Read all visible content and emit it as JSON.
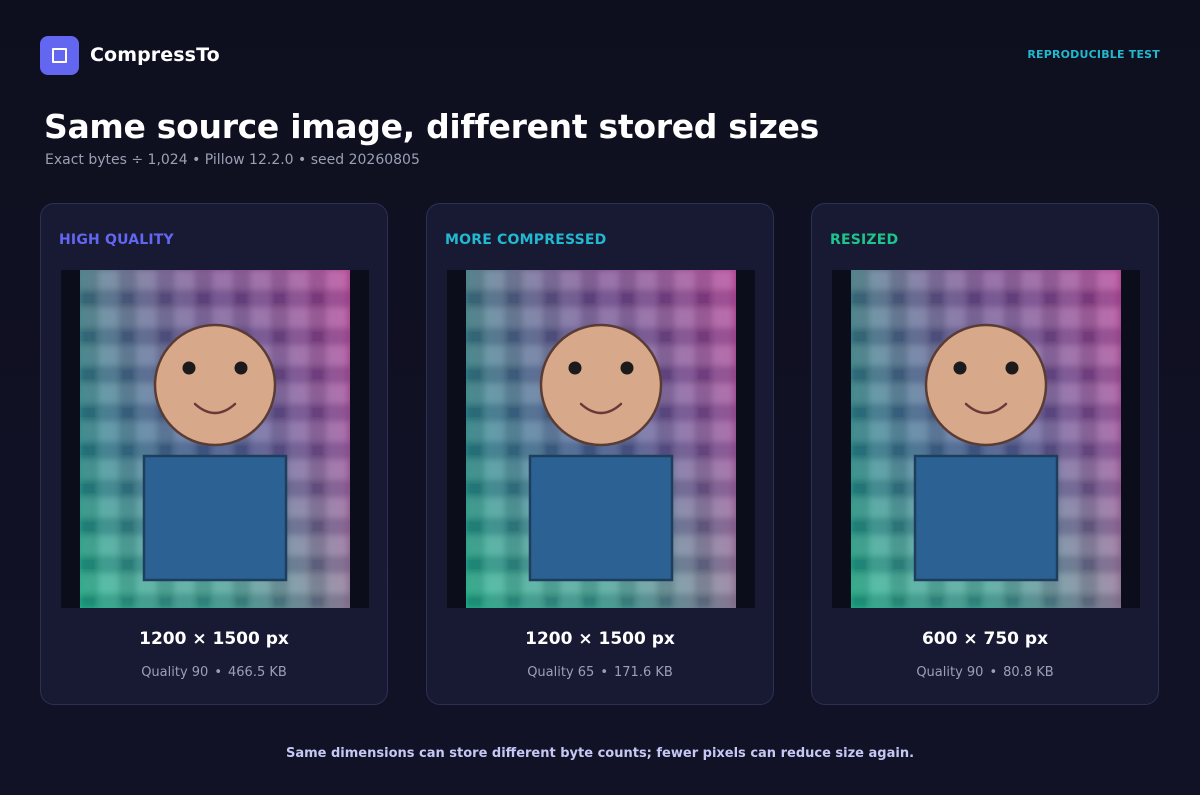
{
  "app": {
    "brand": "CompressTo",
    "badge": "REPRODUCIBLE TEST"
  },
  "heading": {
    "title": "Same source image, different stored sizes",
    "subtitle": "Exact bytes ÷ 1,024 • Pillow 12.2.0 • seed 20260805"
  },
  "colors": {
    "accent": "#6366f1",
    "badge": "#22b8cf",
    "card_bg": "#181a33",
    "high_quality": "#6366f1",
    "more_compressed": "#22b8cf",
    "resized": "#1ec48a"
  },
  "cards": [
    {
      "label": "HIGH QUALITY",
      "label_color": "#6366f1",
      "dimensions": "1200 × 1500 px",
      "quality": "Quality 90",
      "size": "466.5 KB",
      "separator": "•",
      "image_icon": "smiley-figure-on-plaid"
    },
    {
      "label": "MORE COMPRESSED",
      "label_color": "#22b8cf",
      "dimensions": "1200 × 1500 px",
      "quality": "Quality 65",
      "size": "171.6 KB",
      "separator": "•",
      "image_icon": "smiley-figure-on-plaid"
    },
    {
      "label": "RESIZED",
      "label_color": "#1ec48a",
      "dimensions": "600 × 750 px",
      "quality": "Quality 90",
      "size": "80.8 KB",
      "separator": "•",
      "image_icon": "smiley-figure-on-plaid"
    }
  ],
  "footer": {
    "note": "Same dimensions can store different byte counts; fewer pixels can reduce size again."
  }
}
